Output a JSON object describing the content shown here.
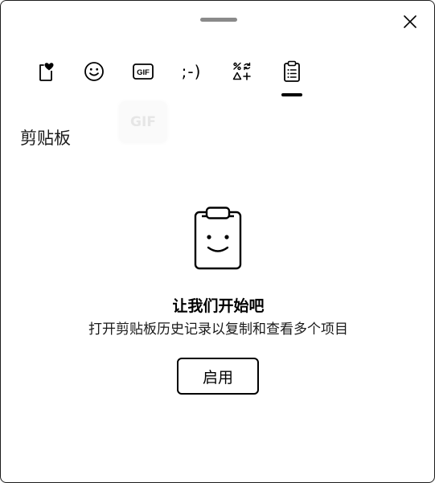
{
  "tabs": [
    {
      "name": "favorites",
      "icon": "heart-clipboard-icon"
    },
    {
      "name": "emoji",
      "icon": "smiley-icon"
    },
    {
      "name": "gif",
      "icon": "gif-icon",
      "label": "GIF"
    },
    {
      "name": "kaomoji",
      "icon": "kaomoji-icon",
      "label": ";-)"
    },
    {
      "name": "symbols",
      "icon": "symbols-icon"
    },
    {
      "name": "clipboard",
      "icon": "clipboard-icon",
      "selected": true
    }
  ],
  "ghost_tooltip": "GIF",
  "section_title": "剪贴板",
  "empty_state": {
    "heading": "让我们开始吧",
    "description": "打开剪贴板历史记录以复制和查看多个项目",
    "button_label": "启用"
  }
}
